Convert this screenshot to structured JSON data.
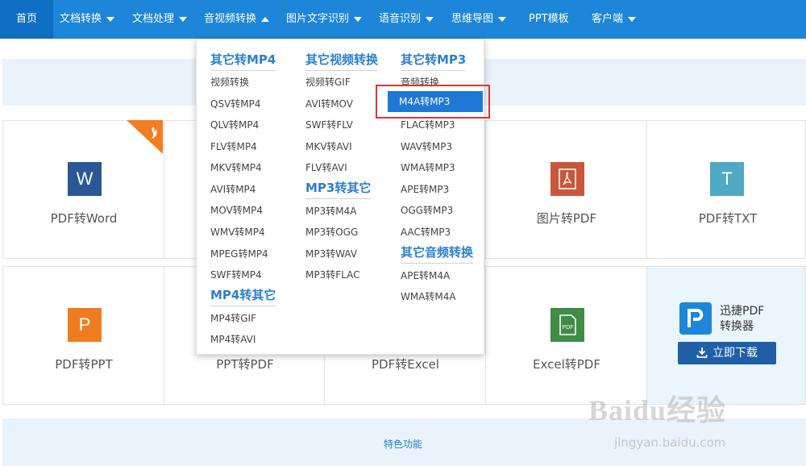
{
  "nav": {
    "items": [
      {
        "label": "首页",
        "has_caret": false,
        "active": true
      },
      {
        "label": "文档转换",
        "has_caret": true
      },
      {
        "label": "文档处理",
        "has_caret": true
      },
      {
        "label": "音视频转换",
        "has_caret": true,
        "open": true
      },
      {
        "label": "图片文字识别",
        "has_caret": true
      },
      {
        "label": "语音识别",
        "has_caret": true
      },
      {
        "label": "思维导图",
        "has_caret": true
      },
      {
        "label": "PPT模板",
        "has_caret": false
      },
      {
        "label": "客户端",
        "has_caret": true
      }
    ],
    "color": "#1d86d9"
  },
  "dropdown": {
    "col1": {
      "head1": "其它转MP4",
      "items1": [
        "视频转换",
        "QSV转MP4",
        "QLV转MP4",
        "FLV转MP4",
        "MKV转MP4",
        "AVI转MP4",
        "MOV转MP4",
        "WMV转MP4",
        "MPEG转MP4",
        "SWF转MP4"
      ],
      "head2": "MP4转其它",
      "items2": [
        "MP4转GIF",
        "MP4转AVI"
      ]
    },
    "col2": {
      "head1": "其它视频转换",
      "items1": [
        "视频转GIF",
        "AVI转MOV",
        "SWF转FLV",
        "MKV转AVI",
        "FLV转AVI"
      ],
      "head2": "MP3转其它",
      "items2": [
        "MP3转M4A",
        "MP3转OGG",
        "MP3转WAV",
        "MP3转FLAC"
      ]
    },
    "col3": {
      "head1": "其它转MP3",
      "items1": [
        "音频转换",
        "M4A转MP3",
        "FLAC转MP3",
        "WAV转MP3",
        "WMA转MP3",
        "APE转MP3",
        "OGG转MP3",
        "AAC转MP3"
      ],
      "head2": "其它音频转换",
      "items2": [
        "APE转M4A",
        "WMA转M4A"
      ],
      "highlighted": "M4A转MP3"
    }
  },
  "tools": {
    "pdf_word": {
      "label": "PDF转Word",
      "icon_letter": "W",
      "color": "#2b5797"
    },
    "img_pdf": {
      "label": "图片转PDF",
      "color": "#c9573a"
    },
    "pdf_txt": {
      "label": "PDF转TXT",
      "icon_letter": "T",
      "color": "#4fa9c4"
    },
    "pdf_ppt": {
      "label": "PDF转PPT",
      "icon_letter": "P",
      "color": "#f07c20"
    },
    "ppt_pdf": {
      "label": "PPT转PDF"
    },
    "pdf_excel": {
      "label": "PDF转Excel"
    },
    "excel_pdf": {
      "label": "Excel转PDF",
      "color": "#3e8c45"
    }
  },
  "promo": {
    "title_line1": "迅捷PDF",
    "title_line2": "转换器",
    "button": "立即下载"
  },
  "section": {
    "featured": "特色功能"
  },
  "watermark": {
    "text": "Baidu经验",
    "sub": "jingyan.baidu.com"
  }
}
